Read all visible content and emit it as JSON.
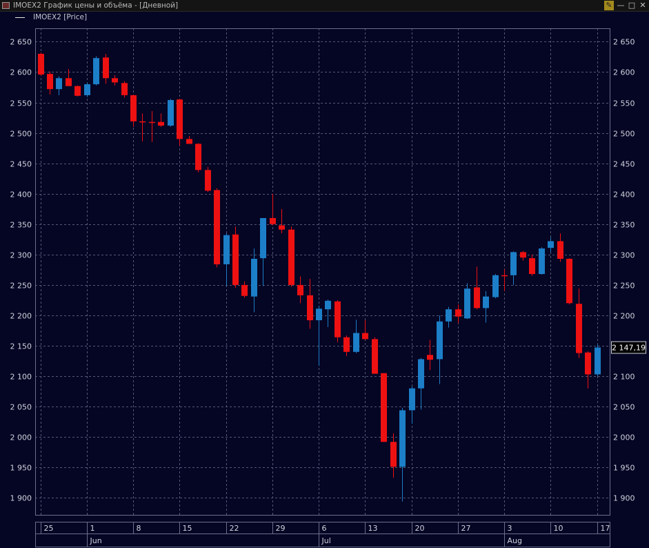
{
  "window": {
    "title": "IMOEX2 График цены и объёма - [Дневной]"
  },
  "legend": {
    "label": "IMOEX2 [Price]",
    "color": "#e8e8e8"
  },
  "colors": {
    "background": "#050524",
    "up": "#1c7fc8",
    "down": "#ee1111",
    "grid": "#545a78",
    "axis_text": "#cfd3dd"
  },
  "price_axis": {
    "ticks": [
      {
        "value": 2650,
        "label": "2 650"
      },
      {
        "value": 2600,
        "label": "2 600"
      },
      {
        "value": 2550,
        "label": "2 550"
      },
      {
        "value": 2500,
        "label": "2 500"
      },
      {
        "value": 2450,
        "label": "2 450"
      },
      {
        "value": 2400,
        "label": "2 400"
      },
      {
        "value": 2350,
        "label": "2 350"
      },
      {
        "value": 2300,
        "label": "2 300"
      },
      {
        "value": 2250,
        "label": "2 250"
      },
      {
        "value": 2200,
        "label": "2 200"
      },
      {
        "value": 2150,
        "label": "2 150"
      },
      {
        "value": 2100,
        "label": "2 100"
      },
      {
        "value": 2050,
        "label": "2 050"
      },
      {
        "value": 2000,
        "label": "2 000"
      },
      {
        "value": 1950,
        "label": "1 950"
      },
      {
        "value": 1900,
        "label": "1 900"
      }
    ],
    "last_price": 2147.19,
    "last_price_label": "2 147,19"
  },
  "chart_data": {
    "type": "candlestick",
    "ylim": [
      1872,
      2672
    ],
    "grid": true,
    "x_ticks": [
      {
        "index": 0,
        "label": "25"
      },
      {
        "index": 5,
        "label": "1",
        "month": "Jun"
      },
      {
        "index": 10,
        "label": "8"
      },
      {
        "index": 15,
        "label": "15"
      },
      {
        "index": 20,
        "label": "22"
      },
      {
        "index": 25,
        "label": "29"
      },
      {
        "index": 30,
        "label": "6",
        "month": "Jul"
      },
      {
        "index": 35,
        "label": "13"
      },
      {
        "index": 40,
        "label": "20"
      },
      {
        "index": 45,
        "label": "27"
      },
      {
        "index": 50,
        "label": "3",
        "month": "Aug"
      },
      {
        "index": 55,
        "label": "10"
      },
      {
        "index": 60,
        "label": "17"
      }
    ],
    "candles": [
      {
        "o": 2630,
        "h": 2632,
        "l": 2594,
        "c": 2596
      },
      {
        "o": 2597,
        "h": 2601,
        "l": 2563,
        "c": 2572
      },
      {
        "o": 2572,
        "h": 2593,
        "l": 2562,
        "c": 2590
      },
      {
        "o": 2590,
        "h": 2605,
        "l": 2577,
        "c": 2577
      },
      {
        "o": 2577,
        "h": 2578,
        "l": 2560,
        "c": 2561
      },
      {
        "o": 2562,
        "h": 2582,
        "l": 2559,
        "c": 2580
      },
      {
        "o": 2580,
        "h": 2626,
        "l": 2578,
        "c": 2623
      },
      {
        "o": 2624,
        "h": 2630,
        "l": 2581,
        "c": 2590
      },
      {
        "o": 2590,
        "h": 2595,
        "l": 2578,
        "c": 2583
      },
      {
        "o": 2582,
        "h": 2585,
        "l": 2558,
        "c": 2562
      },
      {
        "o": 2562,
        "h": 2563,
        "l": 2510,
        "c": 2519
      },
      {
        "o": 2519,
        "h": 2532,
        "l": 2486,
        "c": 2518
      },
      {
        "o": 2518,
        "h": 2536,
        "l": 2485,
        "c": 2517
      },
      {
        "o": 2518,
        "h": 2532,
        "l": 2510,
        "c": 2512
      },
      {
        "o": 2512,
        "h": 2556,
        "l": 2510,
        "c": 2554
      },
      {
        "o": 2555,
        "h": 2556,
        "l": 2479,
        "c": 2490
      },
      {
        "o": 2490,
        "h": 2495,
        "l": 2482,
        "c": 2482
      },
      {
        "o": 2482,
        "h": 2483,
        "l": 2435,
        "c": 2439
      },
      {
        "o": 2439,
        "h": 2444,
        "l": 2403,
        "c": 2405
      },
      {
        "o": 2406,
        "h": 2409,
        "l": 2279,
        "c": 2284
      },
      {
        "o": 2284,
        "h": 2335,
        "l": 2248,
        "c": 2332
      },
      {
        "o": 2333,
        "h": 2346,
        "l": 2245,
        "c": 2250
      },
      {
        "o": 2250,
        "h": 2256,
        "l": 2229,
        "c": 2232
      },
      {
        "o": 2231,
        "h": 2310,
        "l": 2205,
        "c": 2293
      },
      {
        "o": 2294,
        "h": 2360,
        "l": 2248,
        "c": 2360
      },
      {
        "o": 2360,
        "h": 2400,
        "l": 2348,
        "c": 2350
      },
      {
        "o": 2348,
        "h": 2375,
        "l": 2335,
        "c": 2341
      },
      {
        "o": 2341,
        "h": 2346,
        "l": 2247,
        "c": 2250
      },
      {
        "o": 2250,
        "h": 2264,
        "l": 2220,
        "c": 2233
      },
      {
        "o": 2233,
        "h": 2260,
        "l": 2178,
        "c": 2192
      },
      {
        "o": 2192,
        "h": 2216,
        "l": 2117,
        "c": 2211
      },
      {
        "o": 2210,
        "h": 2226,
        "l": 2181,
        "c": 2224
      },
      {
        "o": 2223,
        "h": 2225,
        "l": 2156,
        "c": 2164
      },
      {
        "o": 2164,
        "h": 2167,
        "l": 2133,
        "c": 2140
      },
      {
        "o": 2140,
        "h": 2193,
        "l": 2138,
        "c": 2171
      },
      {
        "o": 2171,
        "h": 2192,
        "l": 2160,
        "c": 2161
      },
      {
        "o": 2161,
        "h": 2164,
        "l": 2104,
        "c": 2104
      },
      {
        "o": 2105,
        "h": 2105,
        "l": 1992,
        "c": 1992
      },
      {
        "o": 1992,
        "h": 2006,
        "l": 1933,
        "c": 1951
      },
      {
        "o": 1951,
        "h": 2048,
        "l": 1894,
        "c": 2044
      },
      {
        "o": 2044,
        "h": 2083,
        "l": 2022,
        "c": 2080
      },
      {
        "o": 2080,
        "h": 2130,
        "l": 2045,
        "c": 2128
      },
      {
        "o": 2135,
        "h": 2160,
        "l": 2110,
        "c": 2127
      },
      {
        "o": 2128,
        "h": 2200,
        "l": 2087,
        "c": 2190
      },
      {
        "o": 2190,
        "h": 2214,
        "l": 2180,
        "c": 2210
      },
      {
        "o": 2210,
        "h": 2218,
        "l": 2187,
        "c": 2198
      },
      {
        "o": 2195,
        "h": 2253,
        "l": 2194,
        "c": 2244
      },
      {
        "o": 2246,
        "h": 2280,
        "l": 2210,
        "c": 2212
      },
      {
        "o": 2212,
        "h": 2240,
        "l": 2188,
        "c": 2231
      },
      {
        "o": 2230,
        "h": 2268,
        "l": 2228,
        "c": 2266
      },
      {
        "o": 2266,
        "h": 2276,
        "l": 2240,
        "c": 2265
      },
      {
        "o": 2266,
        "h": 2305,
        "l": 2250,
        "c": 2304
      },
      {
        "o": 2304,
        "h": 2306,
        "l": 2290,
        "c": 2295
      },
      {
        "o": 2294,
        "h": 2300,
        "l": 2265,
        "c": 2268
      },
      {
        "o": 2268,
        "h": 2312,
        "l": 2267,
        "c": 2310
      },
      {
        "o": 2311,
        "h": 2328,
        "l": 2304,
        "c": 2322
      },
      {
        "o": 2322,
        "h": 2335,
        "l": 2288,
        "c": 2293
      },
      {
        "o": 2293,
        "h": 2294,
        "l": 2218,
        "c": 2220
      },
      {
        "o": 2219,
        "h": 2244,
        "l": 2130,
        "c": 2138
      },
      {
        "o": 2139,
        "h": 2141,
        "l": 2080,
        "c": 2103
      },
      {
        "o": 2103,
        "h": 2152,
        "l": 2100,
        "c": 2147.19
      }
    ]
  }
}
